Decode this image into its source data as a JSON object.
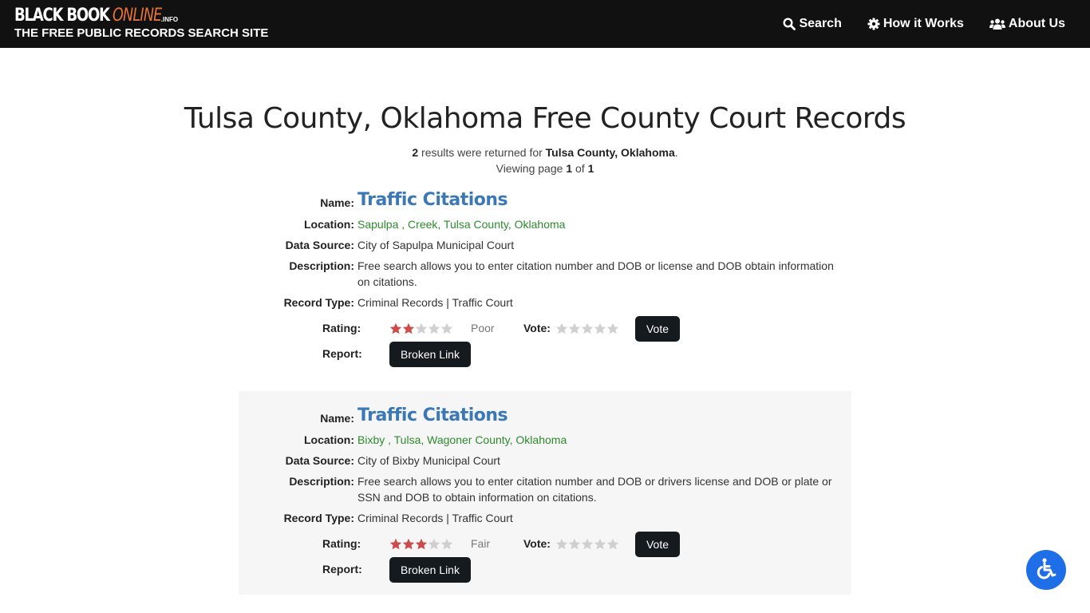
{
  "header": {
    "brand_main": "BLACK BOOK",
    "brand_accent": "ONLINE",
    "brand_tld": ".INFO",
    "tagline": "THE FREE PUBLIC RECORDS SEARCH SITE",
    "nav": [
      {
        "label": "Search",
        "icon": "search-icon"
      },
      {
        "label": "How it Works",
        "icon": "gear-icon"
      },
      {
        "label": "About Us",
        "icon": "users-icon"
      }
    ]
  },
  "page": {
    "title": "Tulsa County, Oklahoma Free County Court Records",
    "result_count": "2",
    "results_text": " results were returned for ",
    "query": "Tulsa County, Oklahoma",
    "viewing_prefix": "Viewing page ",
    "page_current": "1",
    "of_text": " of ",
    "page_total": "1"
  },
  "labels": {
    "name": "Name:",
    "location": "Location:",
    "data_source": "Data Source:",
    "description": "Description:",
    "record_type": "Record Type:",
    "rating": "Rating:",
    "vote": "Vote:",
    "report": "Report:",
    "vote_button": "Vote",
    "broken_link_button": "Broken Link"
  },
  "records": [
    {
      "name": "Traffic Citations",
      "location": "Sapulpa , Creek, Tulsa County, Oklahoma",
      "data_source": "City of Sapulpa Municipal Court",
      "description_line1": "Free search allows you to enter citation number and DOB or license and DOB obtain information",
      "description_line2": "on citations.",
      "record_type": "Criminal Records | Traffic Court",
      "rating_stars": 2,
      "rating_max": 5,
      "rating_word": "Poor"
    },
    {
      "name": "Traffic Citations",
      "location": "Bixby , Tulsa, Wagoner County, Oklahoma",
      "data_source": "City of Bixby Municipal Court",
      "description_line1": "Free search allows you to enter citation number and DOB or drivers license and DOB or plate or",
      "description_line2": "SSN and DOB to obtain information on citations.",
      "record_type": "Criminal Records | Traffic Court",
      "rating_stars": 3,
      "rating_max": 5,
      "rating_word": "Fair"
    }
  ],
  "colors": {
    "navbar_bg": "#111111",
    "brand_accent": "#e8733a",
    "link_blue": "#3a78b8",
    "location_green": "#2d8a2d",
    "star_filled": "#cc4b4b",
    "star_empty": "#d0d0d0",
    "button_dark": "#151a1e",
    "accessibility_blue": "#1e6ee8"
  },
  "accessibility": {
    "icon": "wheelchair-icon"
  }
}
